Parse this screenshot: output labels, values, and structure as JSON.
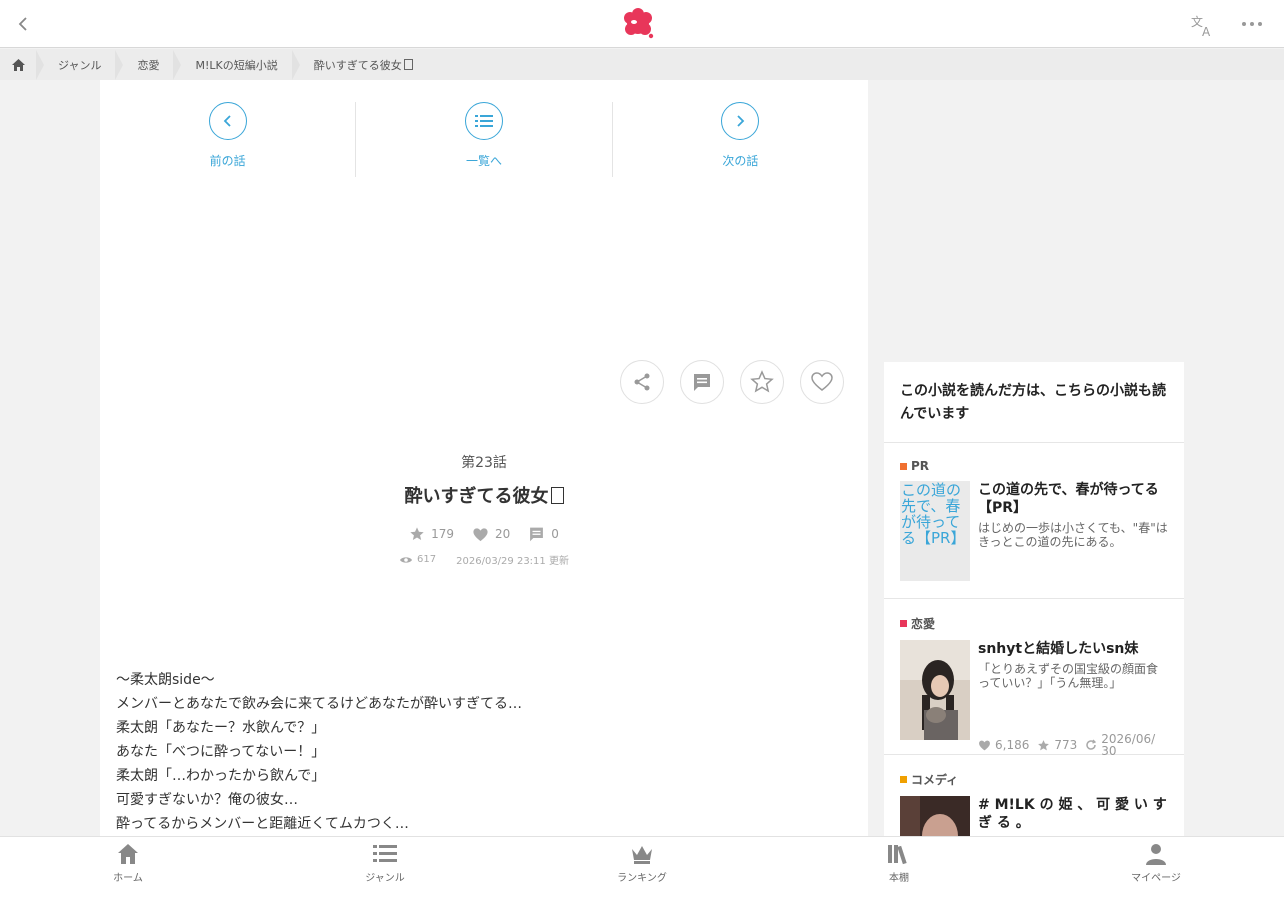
{
  "colors": {
    "accent": "#3aa6d8",
    "brand": "#e8365a",
    "icon_gray": "#9a9a9a"
  },
  "breadcrumb": {
    "home_icon": "home-icon",
    "items": [
      "ジャンル",
      "恋愛",
      "M!LKの短編小説",
      "酔いすぎてる彼女"
    ]
  },
  "nav": {
    "prev_label": "前の話",
    "list_label": "一覧へ",
    "next_label": "次の話"
  },
  "episode": {
    "number": "第23話",
    "title": "酔いすぎてる彼女",
    "stars": "179",
    "likes": "20",
    "comments": "0",
    "views": "617",
    "updated": "2026/03/29 23:11 更新"
  },
  "body_lines": [
    "〜柔太朗side〜",
    "メンバーとあなたで飲み会に来てるけどあなたが酔いすぎてる…",
    "柔太朗「あなたー？水飲んで？」",
    "あなた「べつに酔ってないー！」",
    "柔太朗「…わかったから飲んで」",
    "可愛すぎないか？俺の彼女…",
    "酔ってるからメンバーと距離近くてムカつく…"
  ],
  "sidebar": {
    "heading": "この小説を読んだ方は、こちらの小説も読んでいます",
    "cards": [
      {
        "category": "PR",
        "category_color": "#f07030",
        "thumb_alt": "この道の先で、春が待ってる【PR】",
        "title": "この道の先で、春が待ってる【PR】",
        "desc": "はじめの一歩は小さくても、\"春\"はきっとこの道の先にある。"
      },
      {
        "category": "恋愛",
        "category_color": "#e8365a",
        "title": "snhytと結婚したいsn妹",
        "desc": "「とりあえずその国宝級の顔面食っていい？」「うん無理。」",
        "likes": "6,186",
        "stars": "773",
        "date": "2026/06/30"
      },
      {
        "category": "コメディ",
        "category_color": "#f0a000",
        "title": "# M!LK の 姫 、 可 愛 い す ぎ る 。"
      }
    ]
  },
  "tabs": [
    "ホーム",
    "ジャンル",
    "ランキング",
    "本棚",
    "マイページ"
  ]
}
